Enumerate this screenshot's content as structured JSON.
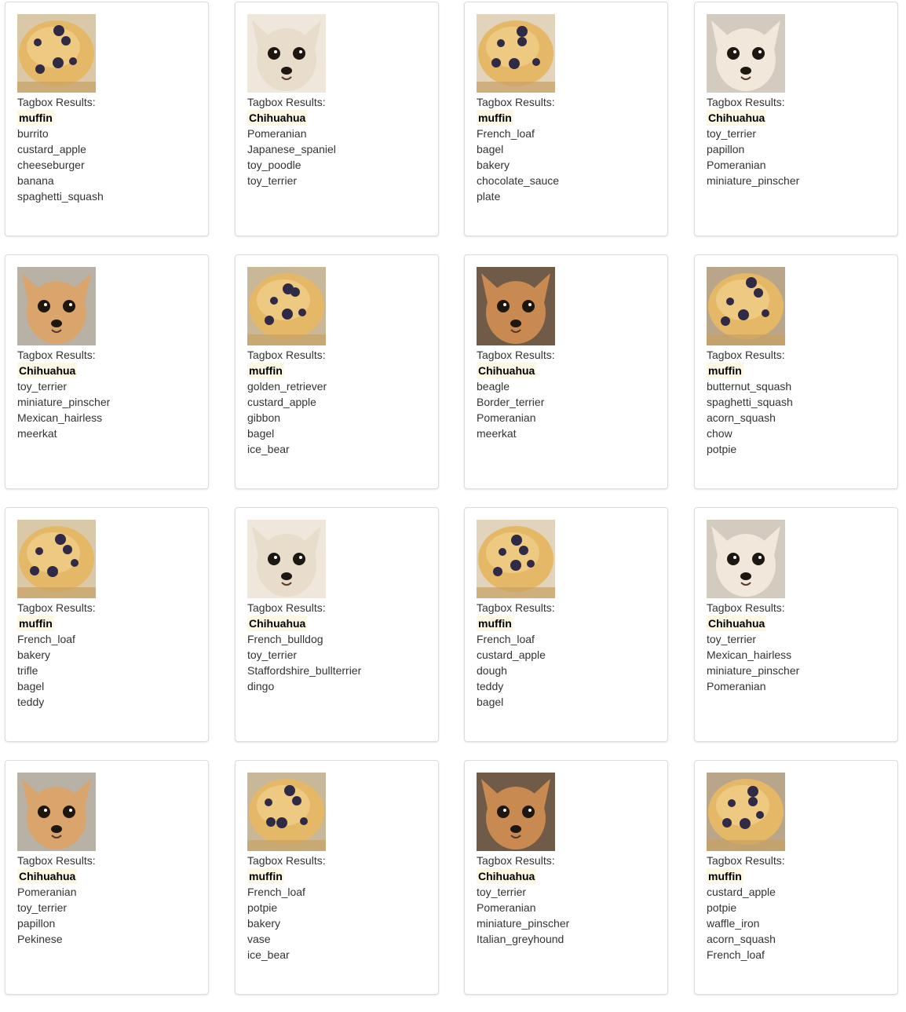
{
  "heading_label": "Tagbox Results:",
  "highlight_color": "#fcf8e3",
  "cards": [
    {
      "image": "muffin-image",
      "top": "muffin",
      "tags": [
        "burrito",
        "custard_apple",
        "cheeseburger",
        "banana",
        "spaghetti_squash"
      ]
    },
    {
      "image": "chihuahua-image",
      "top": "Chihuahua",
      "tags": [
        "Pomeranian",
        "Japanese_spaniel",
        "toy_poodle",
        "toy_terrier"
      ]
    },
    {
      "image": "muffin-image",
      "top": "muffin",
      "tags": [
        "French_loaf",
        "bagel",
        "bakery",
        "chocolate_sauce",
        "plate"
      ]
    },
    {
      "image": "chihuahua-image",
      "top": "Chihuahua",
      "tags": [
        "toy_terrier",
        "papillon",
        "Pomeranian",
        "miniature_pinscher"
      ]
    },
    {
      "image": "chihuahua-image",
      "top": "Chihuahua",
      "tags": [
        "toy_terrier",
        "miniature_pinscher",
        "Mexican_hairless",
        "meerkat"
      ]
    },
    {
      "image": "muffin-image",
      "top": "muffin",
      "tags": [
        "golden_retriever",
        "custard_apple",
        "gibbon",
        "bagel",
        "ice_bear"
      ]
    },
    {
      "image": "chihuahua-image",
      "top": "Chihuahua",
      "tags": [
        "beagle",
        "Border_terrier",
        "Pomeranian",
        "meerkat"
      ]
    },
    {
      "image": "muffin-image",
      "top": "muffin",
      "tags": [
        "butternut_squash",
        "spaghetti_squash",
        "acorn_squash",
        "chow",
        "potpie"
      ]
    },
    {
      "image": "muffin-image",
      "top": "muffin",
      "tags": [
        "French_loaf",
        "bakery",
        "trifle",
        "bagel",
        "teddy"
      ]
    },
    {
      "image": "chihuahua-image",
      "top": "Chihuahua",
      "tags": [
        "French_bulldog",
        "toy_terrier",
        "Staffordshire_bullterrier",
        "dingo"
      ]
    },
    {
      "image": "muffin-image",
      "top": "muffin",
      "tags": [
        "French_loaf",
        "custard_apple",
        "dough",
        "teddy",
        "bagel"
      ]
    },
    {
      "image": "chihuahua-image",
      "top": "Chihuahua",
      "tags": [
        "toy_terrier",
        "Mexican_hairless",
        "miniature_pinscher",
        "Pomeranian"
      ]
    },
    {
      "image": "chihuahua-image",
      "top": "Chihuahua",
      "tags": [
        "Pomeranian",
        "toy_terrier",
        "papillon",
        "Pekinese"
      ]
    },
    {
      "image": "muffin-image",
      "top": "muffin",
      "tags": [
        "French_loaf",
        "potpie",
        "bakery",
        "vase",
        "ice_bear"
      ]
    },
    {
      "image": "chihuahua-image",
      "top": "Chihuahua",
      "tags": [
        "toy_terrier",
        "Pomeranian",
        "miniature_pinscher",
        "Italian_greyhound"
      ]
    },
    {
      "image": "muffin-image",
      "top": "muffin",
      "tags": [
        "custard_apple",
        "potpie",
        "waffle_iron",
        "acorn_squash",
        "French_loaf"
      ]
    }
  ]
}
